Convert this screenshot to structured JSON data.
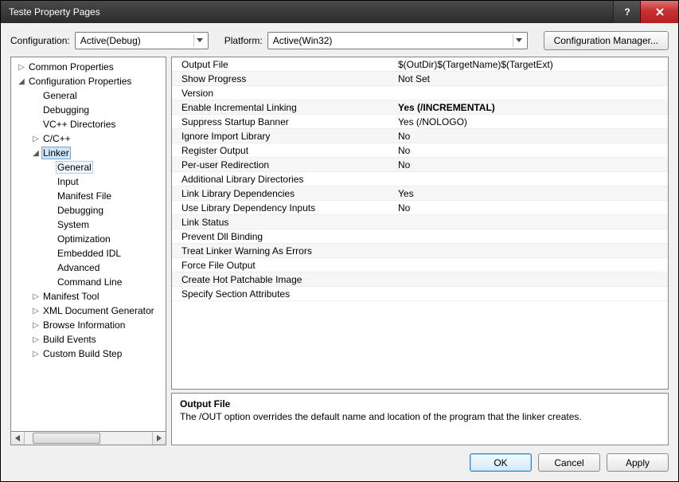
{
  "title": "Teste Property Pages",
  "top": {
    "config_label": "Configuration:",
    "config_value": "Active(Debug)",
    "platform_label": "Platform:",
    "platform_value": "Active(Win32)",
    "cfgmgr": "Configuration Manager..."
  },
  "tree": [
    {
      "label": "Common Properties",
      "indent": 0,
      "toggle": "▷"
    },
    {
      "label": "Configuration Properties",
      "indent": 0,
      "toggle": "◢"
    },
    {
      "label": "General",
      "indent": 1,
      "toggle": ""
    },
    {
      "label": "Debugging",
      "indent": 1,
      "toggle": ""
    },
    {
      "label": "VC++ Directories",
      "indent": 1,
      "toggle": ""
    },
    {
      "label": "C/C++",
      "indent": 1,
      "toggle": "▷"
    },
    {
      "label": "Linker",
      "indent": 1,
      "toggle": "◢",
      "sel2": true
    },
    {
      "label": "General",
      "indent": 2,
      "toggle": "",
      "sel": true
    },
    {
      "label": "Input",
      "indent": 2,
      "toggle": ""
    },
    {
      "label": "Manifest File",
      "indent": 2,
      "toggle": ""
    },
    {
      "label": "Debugging",
      "indent": 2,
      "toggle": ""
    },
    {
      "label": "System",
      "indent": 2,
      "toggle": ""
    },
    {
      "label": "Optimization",
      "indent": 2,
      "toggle": ""
    },
    {
      "label": "Embedded IDL",
      "indent": 2,
      "toggle": ""
    },
    {
      "label": "Advanced",
      "indent": 2,
      "toggle": ""
    },
    {
      "label": "Command Line",
      "indent": 2,
      "toggle": ""
    },
    {
      "label": "Manifest Tool",
      "indent": 1,
      "toggle": "▷"
    },
    {
      "label": "XML Document Generator",
      "indent": 1,
      "toggle": "▷"
    },
    {
      "label": "Browse Information",
      "indent": 1,
      "toggle": "▷"
    },
    {
      "label": "Build Events",
      "indent": 1,
      "toggle": "▷"
    },
    {
      "label": "Custom Build Step",
      "indent": 1,
      "toggle": "▷"
    }
  ],
  "grid": [
    {
      "k": "Output File",
      "v": "$(OutDir)$(TargetName)$(TargetExt)"
    },
    {
      "k": "Show Progress",
      "v": "Not Set"
    },
    {
      "k": "Version",
      "v": ""
    },
    {
      "k": "Enable Incremental Linking",
      "v": "Yes (/INCREMENTAL)",
      "bold": true
    },
    {
      "k": "Suppress Startup Banner",
      "v": "Yes (/NOLOGO)"
    },
    {
      "k": "Ignore Import Library",
      "v": "No"
    },
    {
      "k": "Register Output",
      "v": "No"
    },
    {
      "k": "Per-user Redirection",
      "v": "No"
    },
    {
      "k": "Additional Library Directories",
      "v": ""
    },
    {
      "k": "Link Library Dependencies",
      "v": "Yes"
    },
    {
      "k": "Use Library Dependency Inputs",
      "v": "No"
    },
    {
      "k": "Link Status",
      "v": ""
    },
    {
      "k": "Prevent Dll Binding",
      "v": ""
    },
    {
      "k": "Treat Linker Warning As Errors",
      "v": ""
    },
    {
      "k": "Force File Output",
      "v": ""
    },
    {
      "k": "Create Hot Patchable Image",
      "v": ""
    },
    {
      "k": "Specify Section Attributes",
      "v": ""
    }
  ],
  "desc": {
    "title": "Output File",
    "text": "The /OUT option overrides the default name and location of the program that the linker creates."
  },
  "footer": {
    "ok": "OK",
    "cancel": "Cancel",
    "apply": "Apply"
  }
}
